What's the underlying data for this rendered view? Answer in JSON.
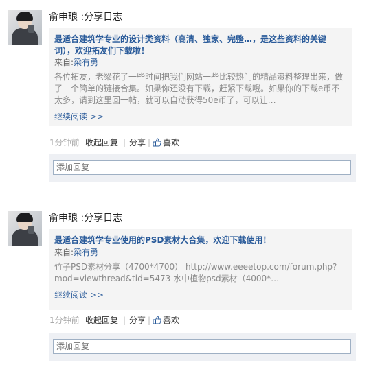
{
  "posts": [
    {
      "title": "俞申琅 :分享日志",
      "headline": "最适合建筑学专业的设计类资料（高清、独家、完整…，是这些资料的关键词），欢迎拓友们下载啦！",
      "from_label": "来自:",
      "author": "梁有勇",
      "excerpt": "各位拓友，老梁花了一些时间把我们网站一些比较热门的精品资料整理出来，做了一个简单的链接合集。如果你还没有下载，赶紧下载哦。如果你的下载e币不太多，请到这里回一帖，就可以自动获得50e币了，可以让…",
      "read_more": "继续阅读 >>",
      "time": "1分钟前",
      "collapse_reply": "收起回复",
      "share": "分享",
      "like": "喜欢",
      "reply_placeholder": "添加回复"
    },
    {
      "title": "俞申琅 :分享日志",
      "headline": "最适合建筑学专业使用的PSD素材大合集，欢迎下载使用！",
      "from_label": "来自:",
      "author": "梁有勇",
      "excerpt": "竹子PSD素材分享（4700*4700） http://www.eeeetop.com/forum.php?mod=viewthread&tid=5473 水中植物psd素材（4000*…",
      "read_more": "继续阅读 >>",
      "time": "1分钟前",
      "collapse_reply": "收起回复",
      "share": "分享",
      "like": "喜欢",
      "reply_placeholder": "添加回复"
    }
  ],
  "separators": {
    "divider": "|"
  },
  "colors": {
    "link": "#2a5b9a",
    "card_bg": "#f4f4f4",
    "reply_bg": "#eef0f4"
  },
  "icons": {
    "avatar": "user-avatar-photo",
    "like": "thumbs-up-icon"
  }
}
